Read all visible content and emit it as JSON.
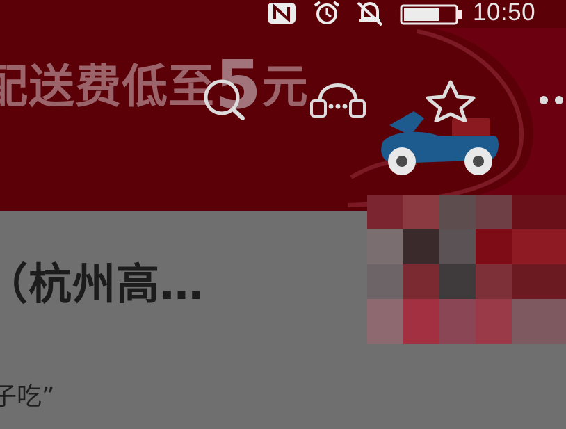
{
  "status_bar": {
    "time": "10:50",
    "icons": [
      "nfc-icon",
      "alarm-icon",
      "notifications-off-icon",
      "battery-icon"
    ]
  },
  "banner": {
    "promo_text": "配送费低至",
    "promo_number": "5",
    "promo_unit": "元",
    "bg_color": "#5c0008"
  },
  "toolbar": {
    "search": "search-icon",
    "customer_service": "customer-service-icon",
    "favorite": "star-icon",
    "more": "more-icon"
  },
  "store": {
    "name": "（杭州高…",
    "slogan": "子吃”"
  }
}
